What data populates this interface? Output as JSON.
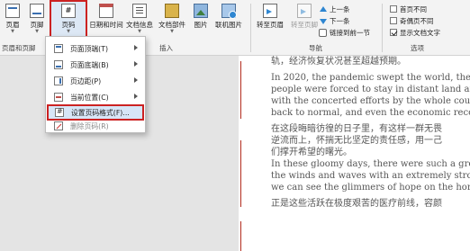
{
  "ribbon": {
    "header_btn": "页眉",
    "footer_btn": "页脚",
    "page_number_btn": "页码",
    "date_time_btn": "日期和时间",
    "doc_info_btn": "文档信息",
    "doc_parts_btn": "文档部件",
    "picture_btn": "图片",
    "online_pic_btn": "联机图片",
    "goto_header_btn": "转至页眉",
    "goto_footer_btn": "转至页脚",
    "prev_btn": "上一条",
    "next_btn": "下一条",
    "link_prev_btn": "链接到前一节",
    "first_page_diff": "首页不同",
    "odd_even_diff": "奇偶页不同",
    "show_doc_text": "显示文档文字",
    "group_header_footer": "页眉和页脚",
    "group_insert": "插入",
    "group_nav": "导航",
    "group_options": "选项",
    "checks": {
      "first_page_diff": false,
      "odd_even_diff": false,
      "show_doc_text": true
    }
  },
  "menu": {
    "top": "页面顶端(T)",
    "bottom": "页面底端(B)",
    "margin": "页边距(P)",
    "current": "当前位置(C)",
    "format": "设置页码格式(F)...",
    "remove": "删除页码(R)"
  },
  "doc": {
    "lines": [
      "轨，经济恢复状况甚至超越预期。",
      "In 2020, the pandemic swept the world, the sp",
      "people were forced to stay in distant land and h",
      "with the concerted efforts by the whole coun",
      "back to normal, and even the economic recove",
      "在这段晦暗彷徨的日子里，有这样一群无畏",
      "逆流而上，怀揣无比坚定的责任感，用一己",
      "们撑开希望的曙光。",
      "In these gloomy days, there were such a group",
      "the winds and waves with an extremely strong",
      "we can see the glimmers of hope on the horizo",
      "正是这些活跃在极度艰苦的医疗前线，容颜"
    ]
  }
}
